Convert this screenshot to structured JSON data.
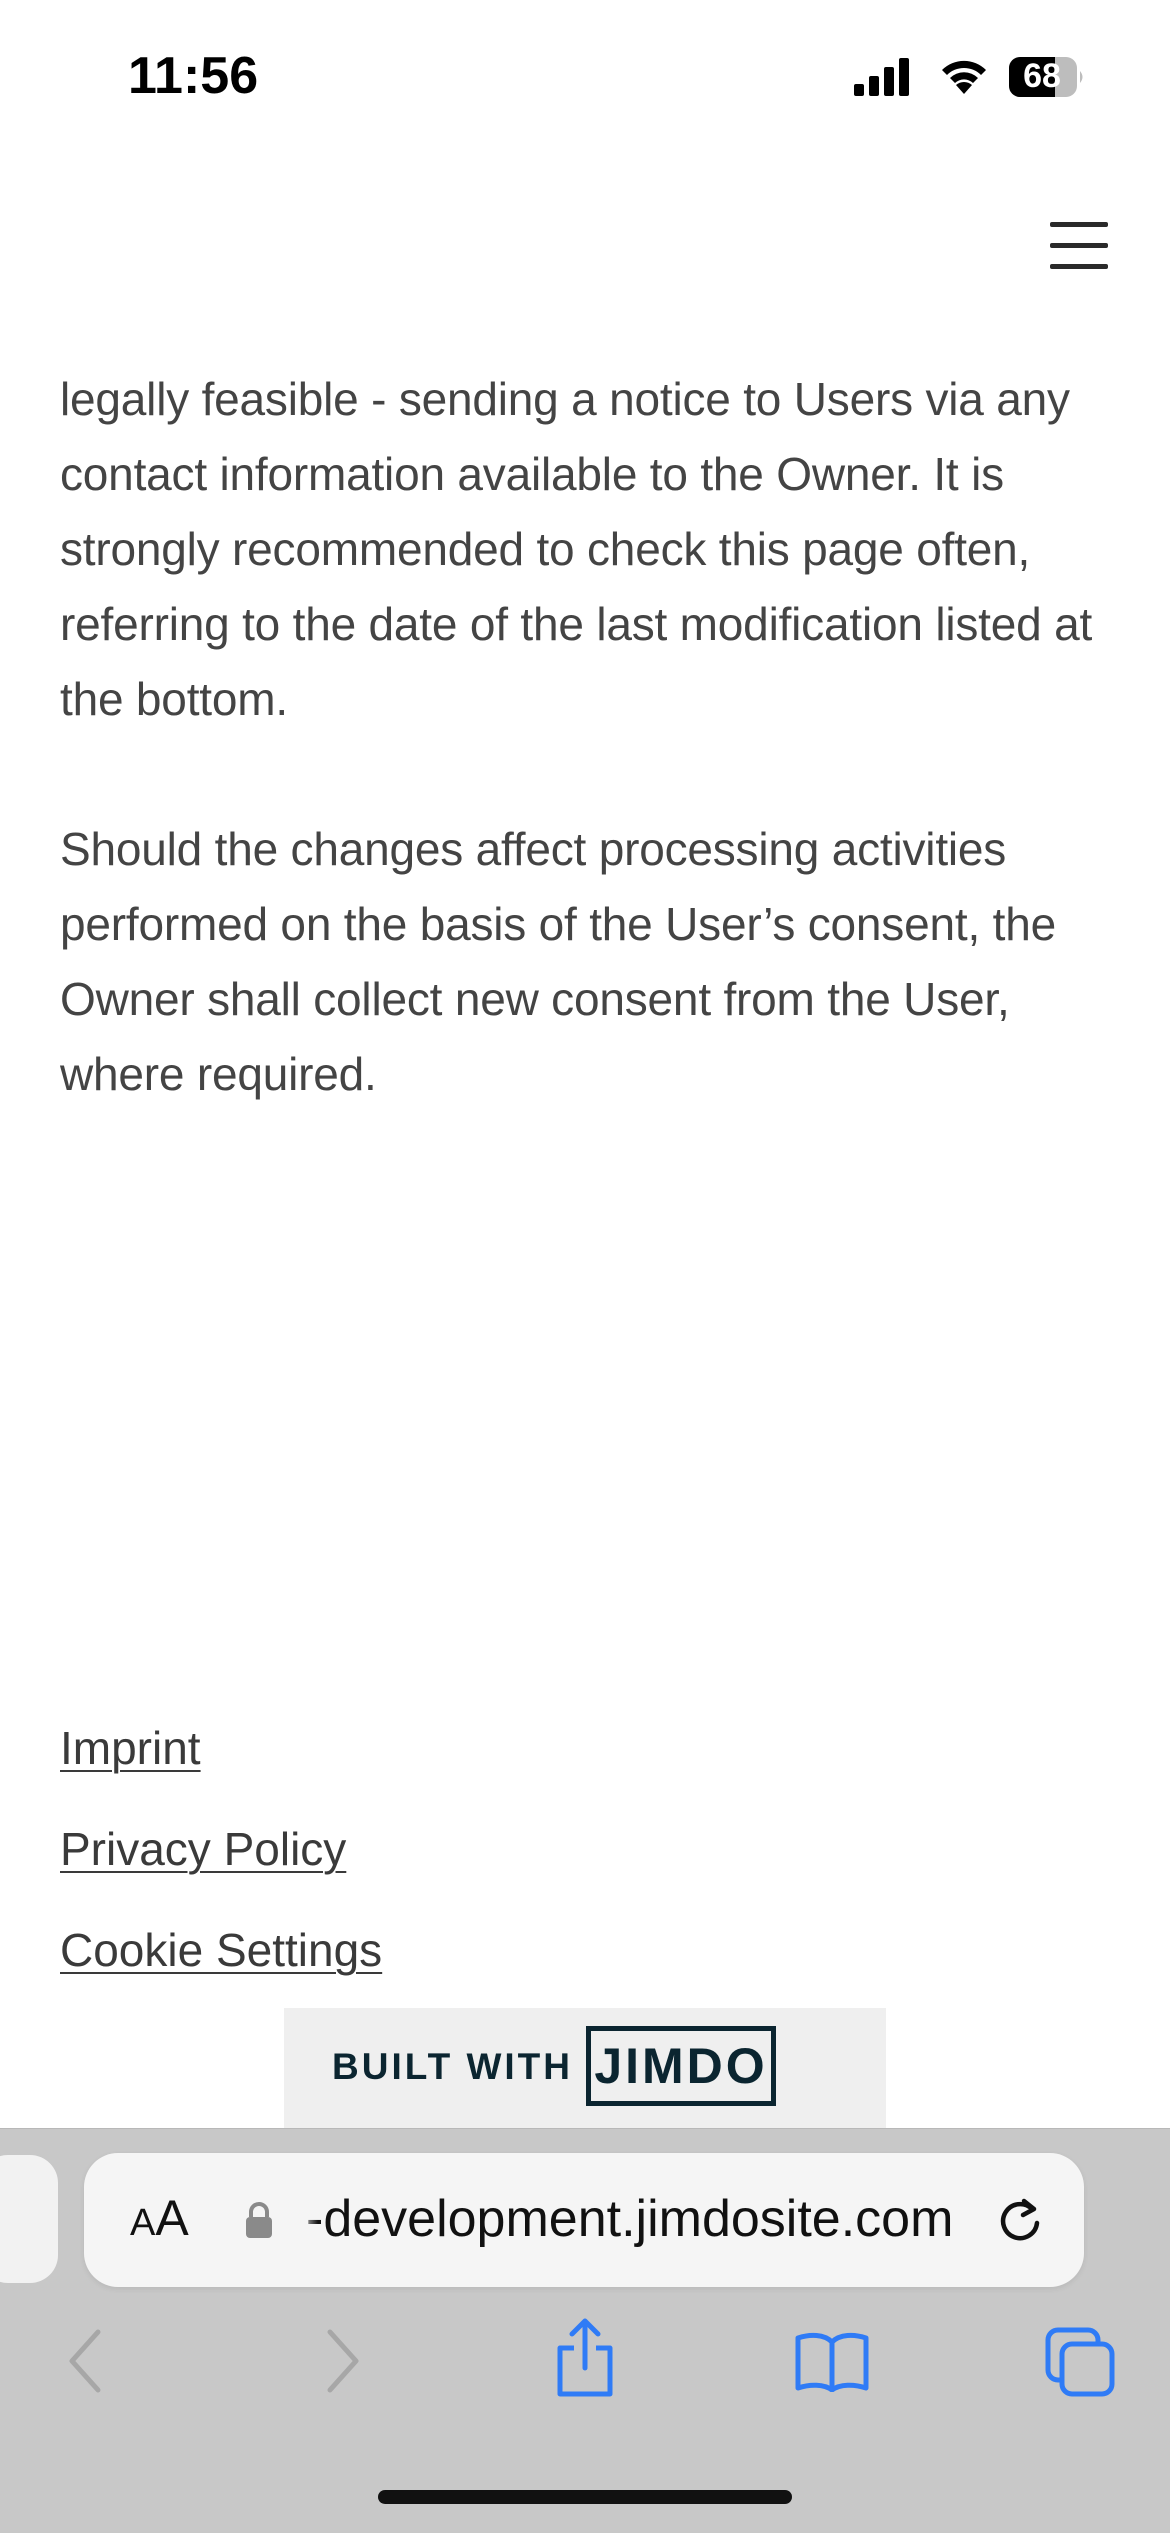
{
  "status_bar": {
    "time": "11:56",
    "battery_level": "68"
  },
  "content": {
    "paragraphs": [
      "legally feasible - sending a notice to Users via any contact information available to the Owner. It is strongly recommended to check this page often, referring to the date of the last modification listed at the bottom.",
      "Should the changes affect processing activities performed on the basis of the User’s consent, the Owner shall collect new consent from the User, where required."
    ]
  },
  "footer": {
    "links": [
      "Imprint",
      "Privacy Policy",
      "Cookie Settings"
    ]
  },
  "jimdo_banner": {
    "built_with": "BUILT WITH",
    "logo_text": "JIMDO"
  },
  "browser": {
    "aa_small": "A",
    "aa_big": "A",
    "url": "-development.jimdosite.com",
    "accent_color": "#2f7bf6",
    "disabled_color": "#a7a7a7"
  },
  "icons": {
    "menu": "hamburger-menu-icon",
    "lock": "lock-icon",
    "reload": "reload-icon",
    "back": "chevron-left-icon",
    "forward": "chevron-right-icon",
    "share": "share-icon",
    "bookmarks": "book-icon",
    "tabs": "tabs-icon"
  }
}
